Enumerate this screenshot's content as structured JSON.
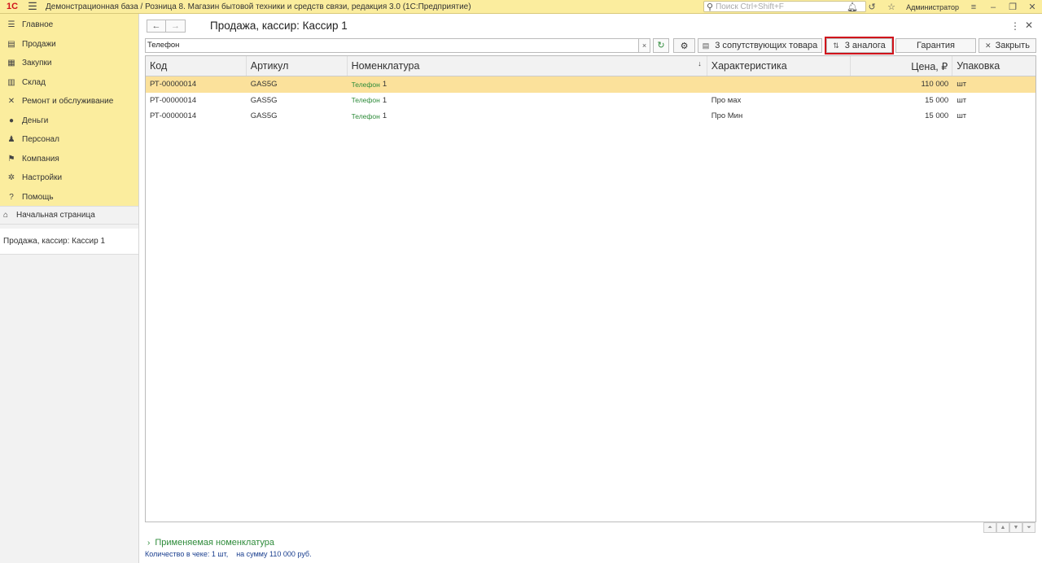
{
  "app": {
    "logo": "1С",
    "title": "Демонстрационная база / Розница 8. Магазин бытовой техники и средств связи, редакция 3.0  (1С:Предприятие)",
    "search_placeholder": "Поиск Ctrl+Shift+F",
    "user": "Администратор"
  },
  "sidebar": {
    "items": [
      {
        "label": "Главное",
        "icon": "menu-icon"
      },
      {
        "label": "Продажи",
        "icon": "sales-icon"
      },
      {
        "label": "Закупки",
        "icon": "purchases-icon"
      },
      {
        "label": "Склад",
        "icon": "warehouse-icon"
      },
      {
        "label": "Ремонт и обслуживание",
        "icon": "tools-icon"
      },
      {
        "label": "Деньги",
        "icon": "money-icon"
      },
      {
        "label": "Персонал",
        "icon": "people-icon"
      },
      {
        "label": "Компания",
        "icon": "flag-icon"
      },
      {
        "label": "Настройки",
        "icon": "gear-icon"
      },
      {
        "label": "Помощь",
        "icon": "help-icon"
      }
    ],
    "home": "Начальная страница",
    "open_window": "Продажа, кассир: Кассир 1"
  },
  "form": {
    "title": "Продажа, кассир: Кассир 1",
    "search_value": "Телефон",
    "btn_related": "3 сопутствующих товара",
    "btn_analogs": "3 аналога",
    "btn_warranty": "Гарантия",
    "btn_close": "Закрыть"
  },
  "table": {
    "columns": [
      "Код",
      "Артикул",
      "Номенклатура",
      "Характеристика",
      "Цена, ₽",
      "Упаковка"
    ],
    "rows": [
      {
        "code": "РТ-00000014",
        "article": "GAS5G",
        "nom_name": "Телефон",
        "nom_num": "1",
        "char": "",
        "price": "110 000",
        "pack": "шт"
      },
      {
        "code": "РТ-00000014",
        "article": "GAS5G",
        "nom_name": "Телефон",
        "nom_num": "1",
        "char": "Про мах",
        "price": "15 000",
        "pack": "шт"
      },
      {
        "code": "РТ-00000014",
        "article": "GAS5G",
        "nom_name": "Телефон",
        "nom_num": "1",
        "char": "Про Мин",
        "price": "15 000",
        "pack": "шт"
      }
    ]
  },
  "footer": {
    "applied": "Применяемая номенклатура",
    "status": "Количество в чеке: 1 шт,    на сумму 110 000 руб."
  }
}
